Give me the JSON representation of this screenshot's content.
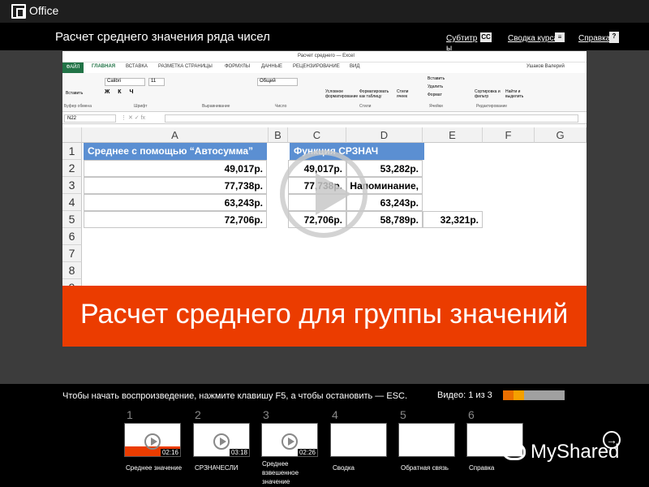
{
  "app": {
    "name": "Office"
  },
  "header": {
    "title": "Расчет среднего значения ряда чисел",
    "subtitles": "Субтитр ы",
    "subtitles_icon": "CC",
    "summary": "Сводка курса",
    "help": "Справка",
    "help_icon": "?"
  },
  "video": {
    "excel_window_title": "Расчет среднего — Excel",
    "user": "Ушаков Валерий",
    "tabs": [
      "ФАЙЛ",
      "ГЛАВНАЯ",
      "ВСТАВКА",
      "РАЗМЕТКА СТРАНИЦЫ",
      "ФОРМУЛЫ",
      "ДАННЫЕ",
      "РЕЦЕНЗИРОВАНИЕ",
      "ВИД"
    ],
    "ribbon_groups": [
      "Буфер обмена",
      "Шрифт",
      "Выравнивание",
      "Число",
      "Стили",
      "Ячейки",
      "Редактирование"
    ],
    "font_name": "Calibri",
    "font_size": "11",
    "number_format": "Общий",
    "ribbon_items": {
      "paste": "Вставить",
      "conditional": "Условное форматирование",
      "format_table": "Форматировать как таблицу",
      "cell_styles": "Стили ячеек",
      "insert": "Вставить",
      "delete": "Удалить",
      "format": "Формат",
      "sort": "Сортировка и фильтр",
      "find": "Найти и выделить"
    },
    "name_box": "N22",
    "columns": [
      "A",
      "B",
      "C",
      "D",
      "E",
      "F",
      "G"
    ],
    "rows": [
      "1",
      "2",
      "3",
      "4",
      "5",
      "6",
      "7",
      "8",
      "9"
    ],
    "header_a": "Среднее с помощью “Автосумма”",
    "header_c": "Функция СРЗНАЧ",
    "col_a": [
      "49,017р.",
      "77,738р.",
      "63,243р.",
      "72,706р."
    ],
    "col_c": [
      "49,017р.",
      "77,738р.",
      "",
      "72,706р."
    ],
    "col_d": [
      "53,282р.",
      "Напоминание,",
      "63,243р.",
      "58,789р."
    ],
    "e5": "32,321р.",
    "banner": "Расчет среднего для группы значений",
    "play_icon": "play-icon"
  },
  "footer": {
    "instruction": "Чтобы начать воспроизведение, нажмите клавишу F5, а чтобы остановить — ESC.",
    "video_counter": "Видео: 1 из 3",
    "progress": {
      "watched_fraction": 0.17,
      "colors": [
        "#eb6f00",
        "#f5a000",
        "#a0a0a0"
      ]
    },
    "thumbnails": [
      {
        "num": "1",
        "time": "02:16",
        "label": "Среднее значение"
      },
      {
        "num": "2",
        "time": "03:18",
        "label": "СРЗНАЧЕСЛИ"
      },
      {
        "num": "3",
        "time": "02:26",
        "label": "Среднее взвешенное значение"
      },
      {
        "num": "4",
        "time": "",
        "label": "Сводка"
      },
      {
        "num": "5",
        "time": "",
        "label": "Обратная связь"
      },
      {
        "num": "6",
        "time": "",
        "label": "Справка"
      }
    ],
    "brand": "MyShared"
  }
}
